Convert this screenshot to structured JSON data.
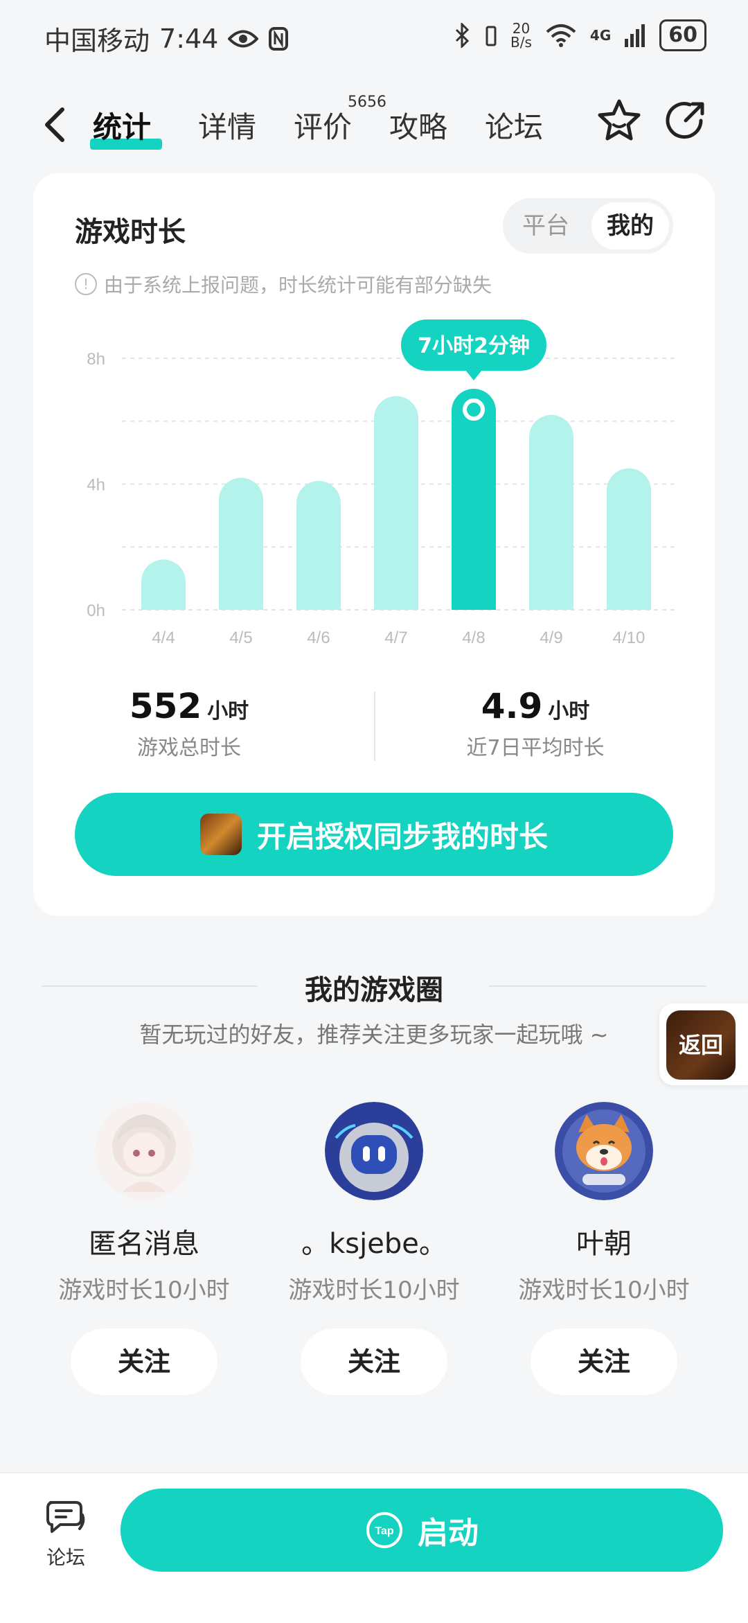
{
  "status_bar": {
    "carrier": "中国移动",
    "time": "7:44",
    "net_speed_value": "20",
    "net_speed_unit": "B/s",
    "network_type": "4G",
    "battery": "60"
  },
  "nav": {
    "tabs": [
      {
        "label": "统计"
      },
      {
        "label": "详情"
      },
      {
        "label": "评价"
      },
      {
        "label": "攻略"
      },
      {
        "label": "论坛"
      }
    ],
    "review_count": "5656",
    "active_tab": "统计"
  },
  "playtime_card": {
    "title": "游戏时长",
    "segment": {
      "options": [
        "平台",
        "我的"
      ],
      "selected": "我的"
    },
    "notice": "由于系统上报问题，时长统计可能有部分缺失",
    "tooltip": "7小时2分钟",
    "total_hours": "552",
    "total_unit": "小时",
    "total_label": "游戏总时长",
    "avg_hours": "4.9",
    "avg_unit": "小时",
    "avg_label": "近7日平均时长",
    "auth_button": "开启授权同步我的时长"
  },
  "chart_data": {
    "type": "bar",
    "categories": [
      "4/4",
      "4/5",
      "4/6",
      "4/7",
      "4/8",
      "4/9",
      "4/10"
    ],
    "values": [
      1.6,
      4.2,
      4.1,
      6.8,
      7.03,
      6.2,
      4.5
    ],
    "highlight_index": 4,
    "yticks": [
      "0h",
      "4h",
      "8h"
    ],
    "ylim": [
      0,
      8
    ],
    "grid": true,
    "colors": {
      "bar": "#b4f2ec",
      "highlight": "#14d3c1"
    }
  },
  "game_circle": {
    "title": "我的游戏圈",
    "subtitle": "暂无玩过的好友，推荐关注更多玩家一起玩哦 ~",
    "users": [
      {
        "name": "匿名消息",
        "playtime": "游戏时长10小时",
        "follow_label": "关注"
      },
      {
        "name": "。ksjebe。",
        "playtime": "游戏时长10小时",
        "follow_label": "关注"
      },
      {
        "name": "叶朝",
        "playtime": "游戏时长10小时",
        "follow_label": "关注"
      }
    ]
  },
  "floating_back": {
    "label": "返回"
  },
  "bottom_bar": {
    "forum_label": "论坛",
    "launch_label": "启动",
    "launch_logo": "Tap"
  },
  "colors": {
    "accent": "#14d3c1",
    "bar_light": "#b4f2ec",
    "background": "#f4f6f8"
  }
}
